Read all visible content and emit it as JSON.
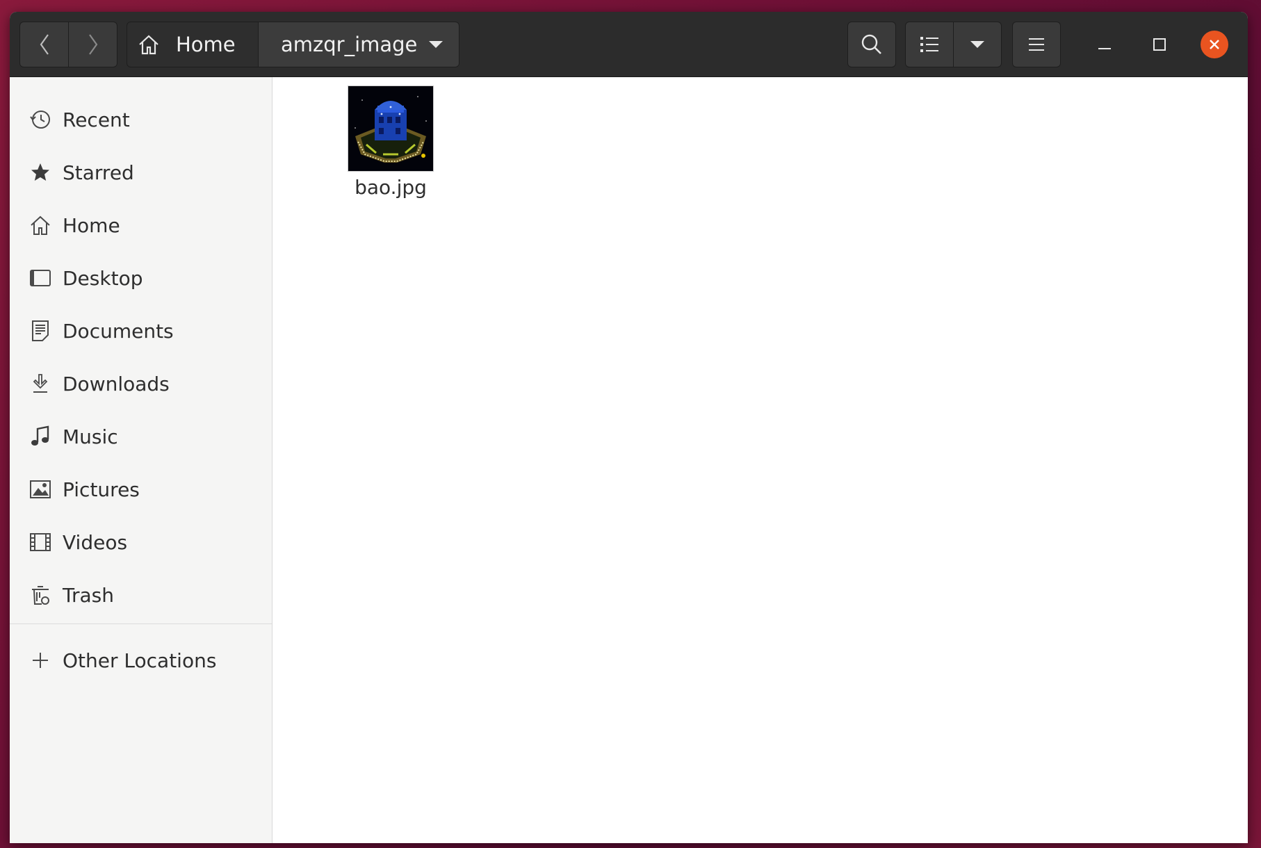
{
  "header": {
    "breadcrumb": {
      "home_label": "Home",
      "current_label": "amzqr_image"
    }
  },
  "sidebar": {
    "items": [
      {
        "label": "Recent",
        "icon": "recent-icon"
      },
      {
        "label": "Starred",
        "icon": "star-icon"
      },
      {
        "label": "Home",
        "icon": "home-icon"
      },
      {
        "label": "Desktop",
        "icon": "desktop-icon"
      },
      {
        "label": "Documents",
        "icon": "documents-icon"
      },
      {
        "label": "Downloads",
        "icon": "downloads-icon"
      },
      {
        "label": "Music",
        "icon": "music-icon"
      },
      {
        "label": "Pictures",
        "icon": "pictures-icon"
      },
      {
        "label": "Videos",
        "icon": "videos-icon"
      },
      {
        "label": "Trash",
        "icon": "trash-icon"
      }
    ],
    "other_locations": {
      "label": "Other Locations",
      "icon": "plus-icon"
    }
  },
  "files": [
    {
      "name": "bao.jpg",
      "type": "image"
    }
  ],
  "colors": {
    "headerbar": "#2c2c2c",
    "close_button": "#e95420",
    "sidebar": "#f5f5f4"
  }
}
